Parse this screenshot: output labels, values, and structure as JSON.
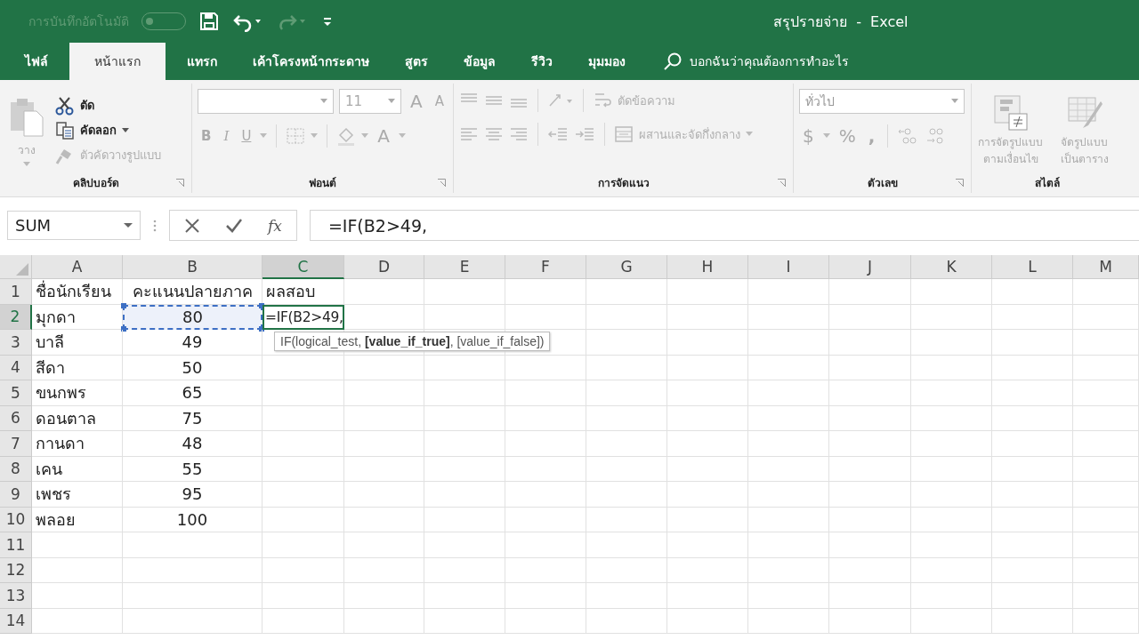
{
  "title_bar": {
    "autosave_label": "การบันทึกอัตโนมัติ",
    "autosave_on": false,
    "document_title": "สรุปรายจ่าย  -  Excel"
  },
  "tabs": [
    {
      "label": "ไฟล์",
      "selected": false
    },
    {
      "label": "หน้าแรก",
      "selected": true
    },
    {
      "label": "แทรก",
      "selected": false
    },
    {
      "label": "เค้าโครงหน้ากระดาษ",
      "selected": false
    },
    {
      "label": "สูตร",
      "selected": false
    },
    {
      "label": "ข้อมูล",
      "selected": false
    },
    {
      "label": "รีวิว",
      "selected": false
    },
    {
      "label": "มุมมอง",
      "selected": false
    }
  ],
  "tell_me": {
    "placeholder": "บอกฉันว่าคุณต้องการทำอะไร"
  },
  "ribbon": {
    "clipboard": {
      "label": "คลิปบอร์ด",
      "paste": {
        "label": "วาง",
        "disabled": true
      },
      "cut": {
        "label": "ตัด",
        "disabled": false
      },
      "copy": {
        "label": "คัดลอก",
        "disabled": false
      },
      "format_painter": {
        "label": "ตัวคัดวางรูปแบบ",
        "disabled": true
      }
    },
    "font": {
      "label": "ฟอนต์",
      "size": "11",
      "grow": "A",
      "shrink": "A",
      "bold": "B",
      "italic": "I",
      "underline": "U",
      "font_color": "A"
    },
    "alignment": {
      "label": "การจัดแนว",
      "wrap_text": "ตัดข้อความ",
      "merge": "ผสานและจัดกึ่งกลาง"
    },
    "number": {
      "label": "ตัวเลข",
      "format": "ทั่วไป",
      "currency": "$",
      "percent": "%",
      "comma": ","
    },
    "styles": {
      "label": "สไตล์",
      "conditional": "การจัดรูปแบบ ตามเงื่อนไข",
      "as_table": "จัดรูปแบบ เป็นตาราง"
    }
  },
  "formula_bar": {
    "name_box": "SUM",
    "fx": "fx",
    "formula": "=IF(B2>49,"
  },
  "columns": [
    {
      "label": "A",
      "selected": false
    },
    {
      "label": "B",
      "selected": false
    },
    {
      "label": "C",
      "selected": true
    },
    {
      "label": "D",
      "selected": false
    },
    {
      "label": "E",
      "selected": false
    },
    {
      "label": "F",
      "selected": false
    },
    {
      "label": "G",
      "selected": false
    },
    {
      "label": "H",
      "selected": false
    },
    {
      "label": "I",
      "selected": false
    },
    {
      "label": "J",
      "selected": false
    },
    {
      "label": "K",
      "selected": false
    },
    {
      "label": "L",
      "selected": false
    },
    {
      "label": "M",
      "selected": false
    }
  ],
  "rows": [
    {
      "number": "1",
      "selected": false,
      "cells": [
        {
          "text": "ชื่อนักเรียน",
          "kind": "plain"
        },
        {
          "text": "คะแนนปลายภาค",
          "kind": "plain"
        },
        {
          "text": "ผลสอบ",
          "kind": "plain"
        }
      ]
    },
    {
      "number": "2",
      "selected": true,
      "cells": [
        {
          "text": "มุกดา",
          "kind": "plain"
        },
        {
          "text": "80",
          "kind": "reference"
        },
        {
          "text": "=IF(B2>49,",
          "kind": "editing"
        }
      ]
    },
    {
      "number": "3",
      "selected": false,
      "cells": [
        {
          "text": "บาลี",
          "kind": "plain"
        },
        {
          "text": "49",
          "kind": "plain"
        }
      ]
    },
    {
      "number": "4",
      "selected": false,
      "cells": [
        {
          "text": "สีดา",
          "kind": "plain"
        },
        {
          "text": "50",
          "kind": "plain"
        }
      ]
    },
    {
      "number": "5",
      "selected": false,
      "cells": [
        {
          "text": "ขนกพร",
          "kind": "plain"
        },
        {
          "text": "65",
          "kind": "plain"
        }
      ]
    },
    {
      "number": "6",
      "selected": false,
      "cells": [
        {
          "text": "ดอนตาล",
          "kind": "plain"
        },
        {
          "text": "75",
          "kind": "plain"
        }
      ]
    },
    {
      "number": "7",
      "selected": false,
      "cells": [
        {
          "text": "กานดา",
          "kind": "plain"
        },
        {
          "text": "48",
          "kind": "plain"
        }
      ]
    },
    {
      "number": "8",
      "selected": false,
      "cells": [
        {
          "text": "เคน",
          "kind": "plain"
        },
        {
          "text": "55",
          "kind": "plain"
        }
      ]
    },
    {
      "number": "9",
      "selected": false,
      "cells": [
        {
          "text": "เพชร",
          "kind": "plain"
        },
        {
          "text": "95",
          "kind": "plain"
        }
      ]
    },
    {
      "number": "10",
      "selected": false,
      "cells": [
        {
          "text": "พลอย",
          "kind": "plain"
        },
        {
          "text": "100",
          "kind": "plain"
        }
      ]
    },
    {
      "number": "11",
      "selected": false,
      "cells": []
    },
    {
      "number": "12",
      "selected": false,
      "cells": []
    },
    {
      "number": "13",
      "selected": false,
      "cells": []
    },
    {
      "number": "14",
      "selected": false,
      "cells": []
    }
  ],
  "tooltip": "IF(logical_test, **[value_if_true]**, [value_if_false])"
}
